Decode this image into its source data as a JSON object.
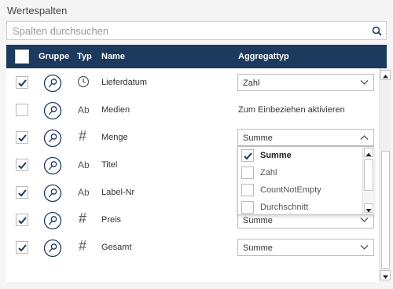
{
  "section_title": "Wertespalten",
  "search": {
    "placeholder": "Spalten durchsuchen"
  },
  "header": {
    "gruppe": "Gruppe",
    "typ": "Typ",
    "name": "Name",
    "aggregattyp": "Aggregattyp"
  },
  "rows": [
    {
      "checked": true,
      "typ_icon": "clock-icon",
      "typ_text": "",
      "name": "Lieferdatum",
      "aggregate": "Zahl",
      "aggregate_is_select": true
    },
    {
      "checked": false,
      "typ_icon": "text-type-icon",
      "typ_text": "Ab",
      "name": "Medien",
      "aggregate": "Zum Einbeziehen aktivieren",
      "aggregate_is_select": false
    },
    {
      "checked": true,
      "typ_icon": "number-type-icon",
      "typ_text": "#",
      "name": "Menge",
      "aggregate": "Summe",
      "aggregate_is_select": true
    },
    {
      "checked": true,
      "typ_icon": "text-type-icon",
      "typ_text": "Ab",
      "name": "Titel",
      "aggregate": "",
      "aggregate_is_select": false
    },
    {
      "checked": true,
      "typ_icon": "text-type-icon",
      "typ_text": "Ab",
      "name": "Label-Nr",
      "aggregate": "",
      "aggregate_is_select": false
    },
    {
      "checked": true,
      "typ_icon": "number-type-icon",
      "typ_text": "#",
      "name": "Preis",
      "aggregate": "Summe",
      "aggregate_is_select": true
    },
    {
      "checked": true,
      "typ_icon": "number-type-icon",
      "typ_text": "#",
      "name": "Gesamt",
      "aggregate": "Summe",
      "aggregate_is_select": true
    }
  ],
  "dropdown": {
    "options": [
      {
        "label": "Summe",
        "checked": true
      },
      {
        "label": "Zahl",
        "checked": false
      },
      {
        "label": "CountNotEmpty",
        "checked": false
      },
      {
        "label": "Durchschnitt",
        "checked": false
      }
    ]
  },
  "colors": {
    "header_bg": "#1c3a5e",
    "check": "#1c3a5e",
    "accent": "#1c3a5e"
  }
}
